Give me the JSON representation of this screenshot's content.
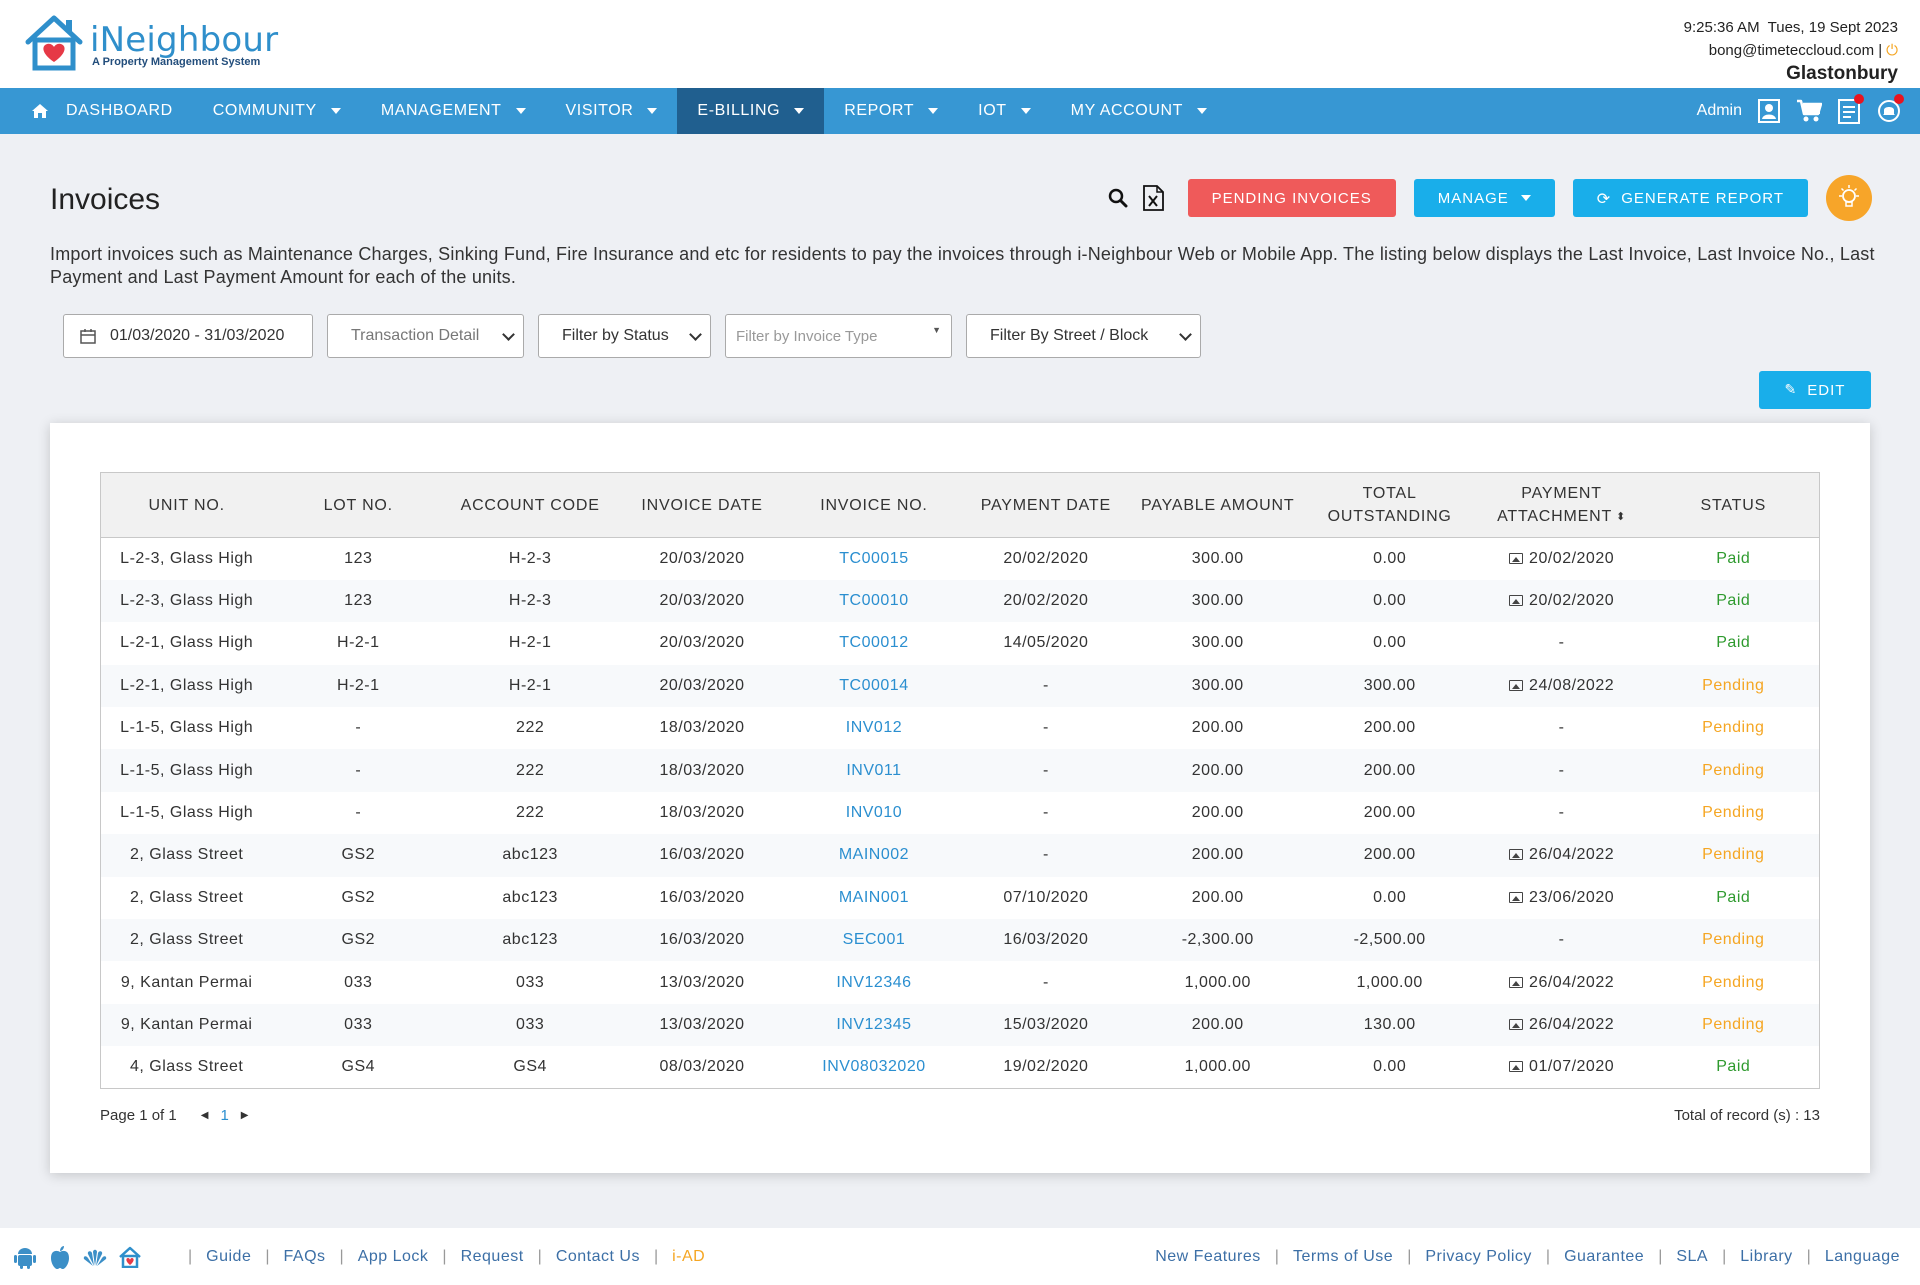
{
  "brand": {
    "name": "iNeighbour",
    "tagline": "A Property Management System"
  },
  "header": {
    "datetime": "9:25:36 AM  Tues, 19 Sept 2023",
    "email": "bong@timeteccloud.com |",
    "estate": "Glastonbury"
  },
  "nav": {
    "items": [
      {
        "label": "DASHBOARD"
      },
      {
        "label": "COMMUNITY"
      },
      {
        "label": "MANAGEMENT"
      },
      {
        "label": "VISITOR"
      },
      {
        "label": "E-BILLING"
      },
      {
        "label": "REPORT"
      },
      {
        "label": "IOT"
      },
      {
        "label": "MY ACCOUNT"
      }
    ],
    "active": "E-BILLING",
    "user": "Admin"
  },
  "page": {
    "title": "Invoices",
    "description": "Import invoices such as Maintenance Charges, Sinking Fund, Fire Insurance and etc for residents to pay the invoices through i-Neighbour Web or Mobile App. The listing below displays the Last Invoice, Last Invoice No., Last Payment and Last Payment Amount for each of the units.",
    "buttons": {
      "pending": "PENDING INVOICES",
      "manage": "MANAGE",
      "generate": "GENERATE REPORT",
      "edit": "EDIT"
    }
  },
  "filters": {
    "date_range": "01/03/2020 - 31/03/2020",
    "transaction": "Transaction Detail",
    "status": "Filter by Status",
    "invoice_type_placeholder": "Filter by Invoice Type",
    "street": "Filter By Street / Block"
  },
  "table": {
    "headers": {
      "unit": "UNIT NO.",
      "lot": "LOT NO.",
      "account": "ACCOUNT CODE",
      "invoice_date": "INVOICE DATE",
      "invoice_no": "INVOICE NO.",
      "payment_date": "PAYMENT DATE",
      "payable": "PAYABLE AMOUNT",
      "outstanding_1": "TOTAL",
      "outstanding_2": "OUTSTANDING",
      "attachment_1": "PAYMENT",
      "attachment_2": "ATTACHMENT",
      "status": "STATUS"
    },
    "rows": [
      {
        "unit": "L-2-3, Glass High",
        "lot": "123",
        "account": "H-2-3",
        "invoice_date": "20/03/2020",
        "invoice_no": "TC00015",
        "payment_date": "20/02/2020",
        "payable": "300.00",
        "outstanding": "0.00",
        "attachment": "20/02/2020",
        "has_img": true,
        "status": "Paid"
      },
      {
        "unit": "L-2-3, Glass High",
        "lot": "123",
        "account": "H-2-3",
        "invoice_date": "20/03/2020",
        "invoice_no": "TC00010",
        "payment_date": "20/02/2020",
        "payable": "300.00",
        "outstanding": "0.00",
        "attachment": "20/02/2020",
        "has_img": true,
        "status": "Paid"
      },
      {
        "unit": "L-2-1, Glass High",
        "lot": "H-2-1",
        "account": "H-2-1",
        "invoice_date": "20/03/2020",
        "invoice_no": "TC00012",
        "payment_date": "14/05/2020",
        "payable": "300.00",
        "outstanding": "0.00",
        "attachment": "-",
        "has_img": false,
        "status": "Paid"
      },
      {
        "unit": "L-2-1, Glass High",
        "lot": "H-2-1",
        "account": "H-2-1",
        "invoice_date": "20/03/2020",
        "invoice_no": "TC00014",
        "payment_date": "-",
        "payable": "300.00",
        "outstanding": "300.00",
        "attachment": "24/08/2022",
        "has_img": true,
        "status": "Pending"
      },
      {
        "unit": "L-1-5, Glass High",
        "lot": "-",
        "account": "222",
        "invoice_date": "18/03/2020",
        "invoice_no": "INV012",
        "payment_date": "-",
        "payable": "200.00",
        "outstanding": "200.00",
        "attachment": "-",
        "has_img": false,
        "status": "Pending"
      },
      {
        "unit": "L-1-5, Glass High",
        "lot": "-",
        "account": "222",
        "invoice_date": "18/03/2020",
        "invoice_no": "INV011",
        "payment_date": "-",
        "payable": "200.00",
        "outstanding": "200.00",
        "attachment": "-",
        "has_img": false,
        "status": "Pending"
      },
      {
        "unit": "L-1-5, Glass High",
        "lot": "-",
        "account": "222",
        "invoice_date": "18/03/2020",
        "invoice_no": "INV010",
        "payment_date": "-",
        "payable": "200.00",
        "outstanding": "200.00",
        "attachment": "-",
        "has_img": false,
        "status": "Pending"
      },
      {
        "unit": "2, Glass Street",
        "lot": "GS2",
        "account": "abc123",
        "invoice_date": "16/03/2020",
        "invoice_no": "MAIN002",
        "payment_date": "-",
        "payable": "200.00",
        "outstanding": "200.00",
        "attachment": "26/04/2022",
        "has_img": true,
        "status": "Pending"
      },
      {
        "unit": "2, Glass Street",
        "lot": "GS2",
        "account": "abc123",
        "invoice_date": "16/03/2020",
        "invoice_no": "MAIN001",
        "payment_date": "07/10/2020",
        "payable": "200.00",
        "outstanding": "0.00",
        "attachment": "23/06/2020",
        "has_img": true,
        "status": "Paid"
      },
      {
        "unit": "2, Glass Street",
        "lot": "GS2",
        "account": "abc123",
        "invoice_date": "16/03/2020",
        "invoice_no": "SEC001",
        "payment_date": "16/03/2020",
        "payable": "-2,300.00",
        "outstanding": "-2,500.00",
        "attachment": "-",
        "has_img": false,
        "status": "Pending"
      },
      {
        "unit": "9, Kantan Permai",
        "lot": "033",
        "account": "033",
        "invoice_date": "13/03/2020",
        "invoice_no": "INV12346",
        "payment_date": "-",
        "payable": "1,000.00",
        "outstanding": "1,000.00",
        "attachment": "26/04/2022",
        "has_img": true,
        "status": "Pending"
      },
      {
        "unit": "9, Kantan Permai",
        "lot": "033",
        "account": "033",
        "invoice_date": "13/03/2020",
        "invoice_no": "INV12345",
        "payment_date": "15/03/2020",
        "payable": "200.00",
        "outstanding": "130.00",
        "attachment": "26/04/2022",
        "has_img": true,
        "status": "Pending"
      },
      {
        "unit": "4, Glass Street",
        "lot": "GS4",
        "account": "GS4",
        "invoice_date": "08/03/2020",
        "invoice_no": "INV08032020",
        "payment_date": "19/02/2020",
        "payable": "1,000.00",
        "outstanding": "0.00",
        "attachment": "01/07/2020",
        "has_img": true,
        "status": "Paid"
      }
    ]
  },
  "pager": {
    "page_text": "Page 1 of 1",
    "current": "1",
    "total_text": "Total of record (s) : 13"
  },
  "footer": {
    "left": [
      "Guide",
      "FAQs",
      "App Lock",
      "Request",
      "Contact Us",
      "i-AD"
    ],
    "right": [
      "New Features",
      "Terms of Use",
      "Privacy Policy",
      "Guarantee",
      "SLA",
      "Library",
      "Language"
    ]
  },
  "colors": {
    "nav": "#3797d3",
    "nav_active": "#205f8f",
    "paid": "#2e9a2e",
    "pending": "#f5a623",
    "link": "#2b8fd0"
  }
}
